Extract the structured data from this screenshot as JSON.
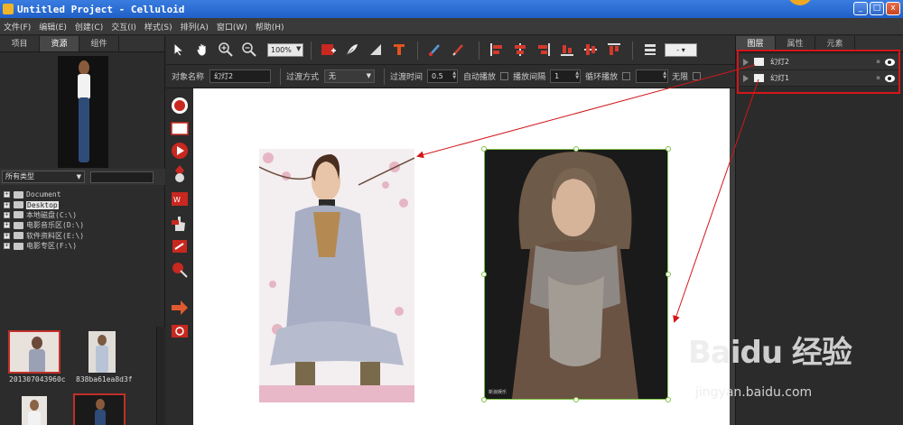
{
  "window": {
    "title": "Untitled Project - Celluloid",
    "controls": [
      "_",
      "□",
      "x"
    ]
  },
  "menu": {
    "items": [
      "文件(F)",
      "编辑(E)",
      "创建(C)",
      "交互(I)",
      "样式(S)",
      "排列(A)",
      "窗口(W)",
      "帮助(H)"
    ]
  },
  "left_panel": {
    "tabs": [
      "项目",
      "资源",
      "组件"
    ],
    "active_tab": "资源",
    "filter_label": "所有类型",
    "tree": [
      {
        "label": "Document",
        "selected": false
      },
      {
        "label": "Desktop",
        "selected": true
      },
      {
        "label": "本地磁盘(C:\\)",
        "selected": false
      },
      {
        "label": "电影音乐区(D:\\)",
        "selected": false
      },
      {
        "label": "软件资料区(E:\\)",
        "selected": false
      },
      {
        "label": "电影专区(F:\\)",
        "selected": false
      }
    ],
    "thumbnails": [
      {
        "label": "201307043960c",
        "selected": true
      },
      {
        "label": "838ba61ea8d3f",
        "selected": false
      },
      {
        "label": "",
        "selected": false
      },
      {
        "label": "",
        "selected": true
      }
    ]
  },
  "toolbar": {
    "zoom": "100%",
    "zoom_arrow": "▼",
    "dash_value": "-",
    "dash_arrow": "▾"
  },
  "property_bar": {
    "object_name_label": "对象名称",
    "object_name_value": "幻灯2",
    "transition_label": "过渡方式",
    "transition_value": "无",
    "transition_time_label": "过渡时间",
    "transition_time_value": "0.5",
    "autoplay_label": "自动播放",
    "interval_label": "播放间隔",
    "interval_value": "1",
    "loop_label": "循环播放",
    "unlimited_label": "无限"
  },
  "right_panel": {
    "tabs": [
      "图层",
      "属性",
      "元素"
    ],
    "active_tab": "图层",
    "layers": [
      {
        "name": "幻灯2",
        "visible": true
      },
      {
        "name": "幻灯1",
        "visible": true
      }
    ]
  },
  "canvas": {
    "right_photo_caption": "新浪娱乐"
  },
  "watermark": {
    "logo": "Baidu 经验",
    "sub": "jingyan.baidu.com"
  },
  "colors": {
    "annotation_red": "#d4161a",
    "selection_green": "#7fc145",
    "titlebar_blue": "#1f5fc7"
  }
}
